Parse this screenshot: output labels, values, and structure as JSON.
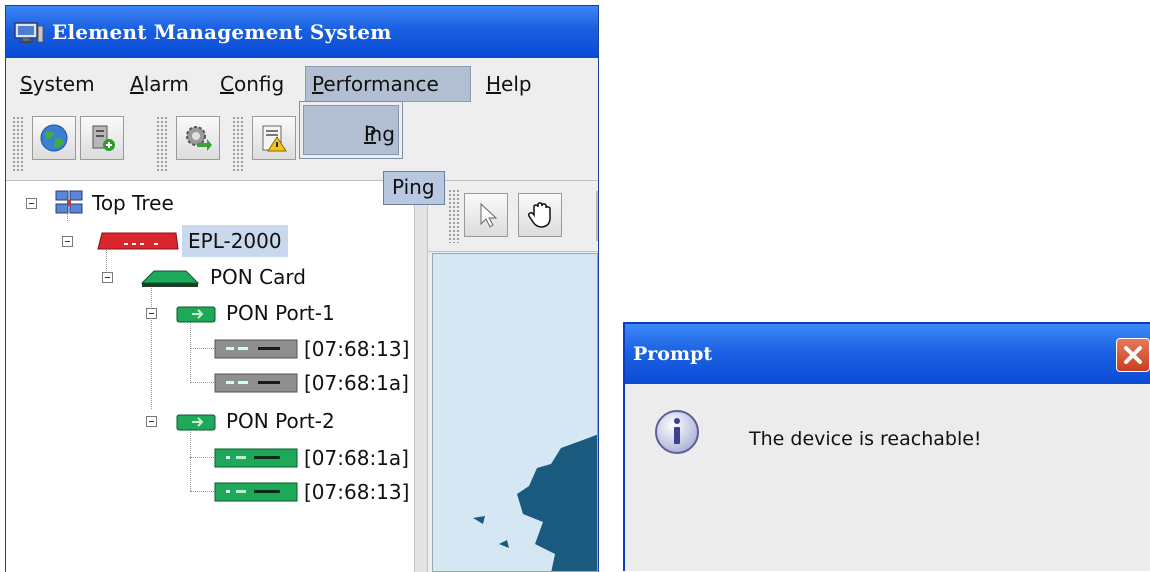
{
  "window": {
    "title": "Element Management System"
  },
  "menubar": {
    "system": {
      "mnemonic": "S",
      "rest": "ystem"
    },
    "alarm": {
      "mnemonic": "A",
      "rest": "larm"
    },
    "config": {
      "mnemonic": "C",
      "rest": "onfig"
    },
    "performance": {
      "mnemonic": "P",
      "rest": "erformance"
    },
    "help": {
      "mnemonic": "H",
      "rest": "elp"
    }
  },
  "performance_menu": {
    "items": [
      {
        "mnemonic": "P",
        "rest": "ing"
      }
    ]
  },
  "tooltip": {
    "text": "Ping"
  },
  "toolbar": {
    "icons": [
      "globe-icon",
      "server-add-icon",
      "gear-arrow-icon",
      "alarm-report-icon"
    ]
  },
  "map_toolbar": {
    "icons": [
      "pointer-icon",
      "hand-pan-icon"
    ]
  },
  "tree": {
    "root": "Top Tree",
    "device": "EPL-2000",
    "card": "PON Card",
    "ports": [
      {
        "label": "PON Port-1",
        "onus": [
          "[07:68:13]",
          "[07:68:1a]"
        ]
      },
      {
        "label": "PON Port-2",
        "onus": [
          "[07:68:1a]",
          "[07:68:13]"
        ]
      }
    ]
  },
  "dialog": {
    "title": "Prompt",
    "message": "The device is reachable!",
    "icon": "info-icon"
  },
  "colors": {
    "titlebar": "#0a4ad4",
    "menu_highlight": "#b2bfd2",
    "device_red": "#d8262c",
    "pon_green": "#1ea85a",
    "close_button": "#c9401e"
  }
}
